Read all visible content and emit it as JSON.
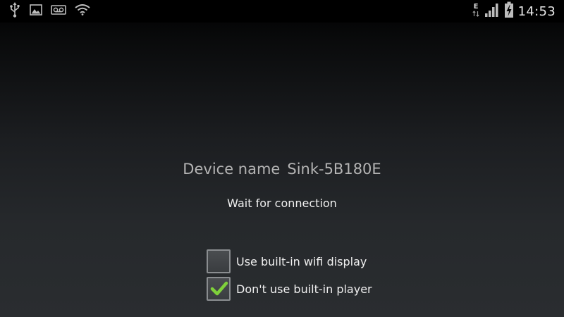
{
  "status_bar": {
    "left_icons": [
      "usb-icon",
      "image-icon",
      "voicemail-icon",
      "wifi-icon"
    ],
    "network_type": "E",
    "right_icons": [
      "data-arrows-icon",
      "signal-icon",
      "battery-charging-icon"
    ],
    "time": "14:53"
  },
  "main": {
    "device_label": "Device name",
    "device_name": "Sink-5B180E",
    "status_text": "Wait for connection"
  },
  "options": [
    {
      "label": "Use built-in wifi display",
      "checked": false
    },
    {
      "label": "Don't use built-in player",
      "checked": true
    }
  ],
  "colors": {
    "checkmark": "#7fd13b",
    "status_bar_bg": "#000000",
    "text_primary": "#f0f0f0",
    "text_secondary": "#b4b4b4"
  }
}
